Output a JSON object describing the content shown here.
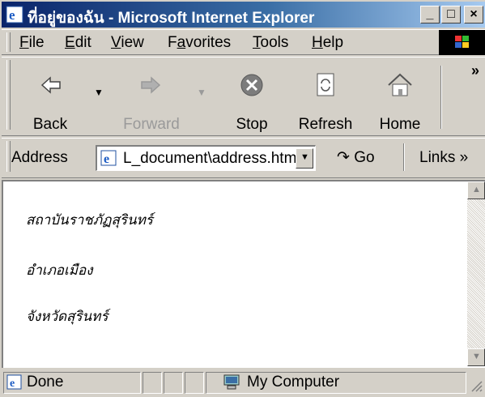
{
  "window": {
    "title": "ที่อยู่ของฉัน - Microsoft Internet Explorer"
  },
  "menu": [
    "File",
    "Edit",
    "View",
    "Favorites",
    "Tools",
    "Help"
  ],
  "menu_underline": [
    "F",
    "E",
    "V",
    "a",
    "T",
    "H"
  ],
  "toolbar": {
    "back_label": "Back",
    "forward_label": "Forward",
    "stop_label": "Stop",
    "refresh_label": "Refresh",
    "home_label": "Home",
    "more": "»"
  },
  "address": {
    "label": "Address",
    "url": "L_document\\address.html",
    "go_label": "Go",
    "links_label": "Links »"
  },
  "content": {
    "lines": [
      "สถาบันราชภัฏสุรินทร์",
      "อำเภอเมือง",
      "จังหวัดสุรินทร์"
    ]
  },
  "status": {
    "text": "Done",
    "zone": "My Computer"
  },
  "colors": {
    "title_start": "#0a246a",
    "title_end": "#a6caf0",
    "chrome": "#d4d0c8"
  }
}
